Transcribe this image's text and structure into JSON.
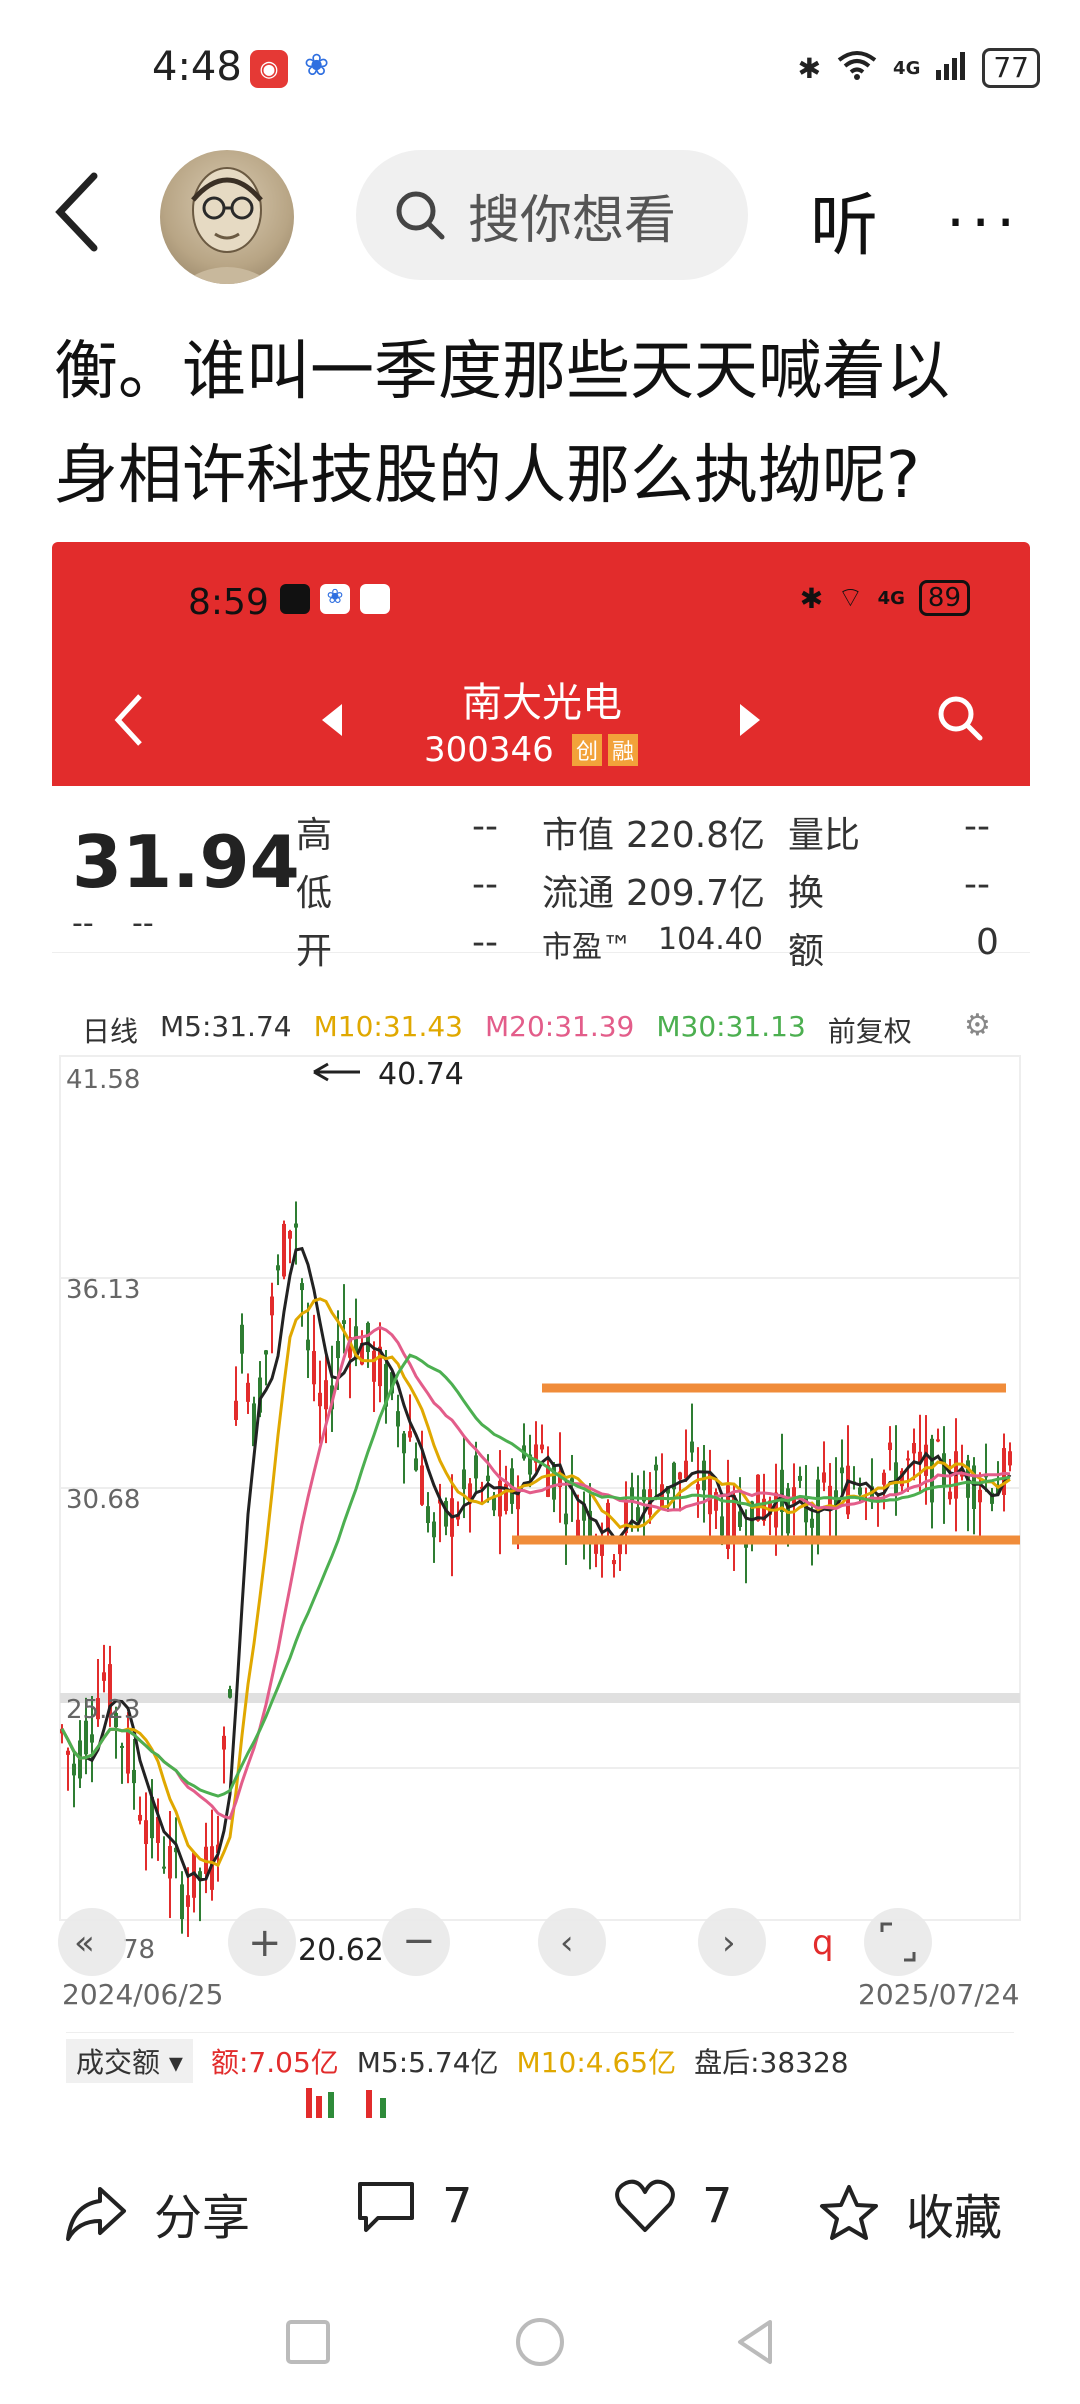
{
  "status_bar": {
    "time": "4:48",
    "network": "4G",
    "battery": "77"
  },
  "top_bar": {
    "search_placeholder": "搜你想看",
    "listen_label": "听",
    "more_label": "···"
  },
  "article": {
    "line1": "衡。谁叫一季度那些天天喊着以",
    "line2": "身相许科技股的人那么执拗呢?"
  },
  "screenshot": {
    "status": {
      "time": "8:59",
      "network": "4G",
      "battery": "89"
    },
    "stock_name": "南大光电",
    "stock_code": "300346",
    "badge1": "创",
    "badge2": "融",
    "price": "31.94",
    "change": "--",
    "change_pct": "--",
    "quote": {
      "high_label": "高",
      "high_value": "--",
      "low_label": "低",
      "low_value": "--",
      "open_label": "开",
      "open_value": "--",
      "mcap_label": "市值",
      "mcap_value": "220.8亿",
      "float_label": "流通",
      "float_value": "209.7亿",
      "pe_label": "市盈™",
      "pe_value": "104.40",
      "vr_label": "量比",
      "vr_value": "--",
      "turnover_label": "换",
      "turnover_value": "--",
      "amount_label": "额",
      "amount_value": "0"
    },
    "ma_bar": {
      "period": "日线",
      "m5": "M5:31.74",
      "m10": "M10:31.43",
      "m20": "M20:31.39",
      "m30": "M30:31.13",
      "adj": "前复权"
    },
    "y_ticks": [
      "41.58",
      "36.13",
      "30.68",
      "25.23",
      "78"
    ],
    "max_label": "40.74",
    "min_label": "20.62",
    "date_start": "2024/06/25",
    "date_end": "2025/07/24",
    "volume_bar": {
      "selector": "成交额",
      "amount": "额:7.05亿",
      "m5": "M5:5.74亿",
      "m10": "M10:4.65亿",
      "after": "盘后:38328"
    }
  },
  "actions": {
    "share": "分享",
    "comments": "7",
    "likes": "7",
    "favorite": "收藏"
  },
  "colors": {
    "red": "#e22c2c",
    "orange": "#f08c3a",
    "m10": "#e0a800",
    "m20": "#e35d8a",
    "m30": "#4caf50"
  }
}
